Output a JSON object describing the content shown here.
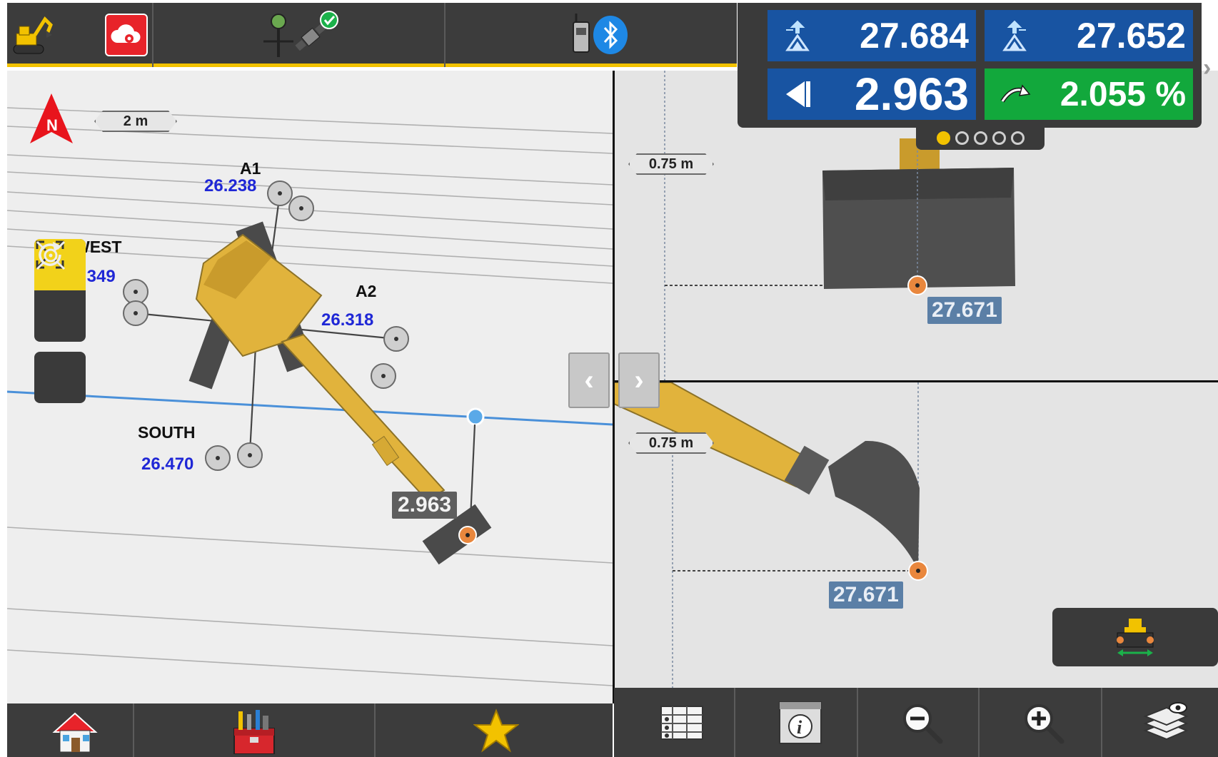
{
  "topbar": {
    "icons": [
      "excavator-icon",
      "cloud-sync-icon",
      "gnss-status-icon",
      "radio-bluetooth-icon"
    ],
    "accent_color": "#f2c200"
  },
  "plan_view": {
    "scale": "2 m",
    "north": "N",
    "points": [
      {
        "label": "A1",
        "value": "26.238"
      },
      {
        "label": "WEST",
        "value": ".349"
      },
      {
        "label": "A2",
        "value": "26.318"
      },
      {
        "label": "SOUTH",
        "value": "26.470"
      }
    ],
    "bucket_tag": "2.963"
  },
  "side_view": {
    "scale": "0.75 m",
    "elevation_tag": "27.671"
  },
  "front_view": {
    "scale": "0.75 m",
    "elevation_tag": "27.671"
  },
  "hud": {
    "left_elevation": "27.684",
    "right_elevation": "27.652",
    "distance": "2.963",
    "slope": "2.055 %",
    "page_count": 5,
    "active_page": 1,
    "colors": {
      "blue": "#1854a2",
      "green": "#12a83c"
    }
  },
  "nav": {
    "prev": "‹",
    "next": "›"
  },
  "bottom_left": [
    "home-icon",
    "toolbox-icon",
    "favorites-star-icon"
  ],
  "bottom_right": [
    "table-icon",
    "info-icon",
    "zoom-out-icon",
    "zoom-in-icon",
    "layers-icon"
  ]
}
